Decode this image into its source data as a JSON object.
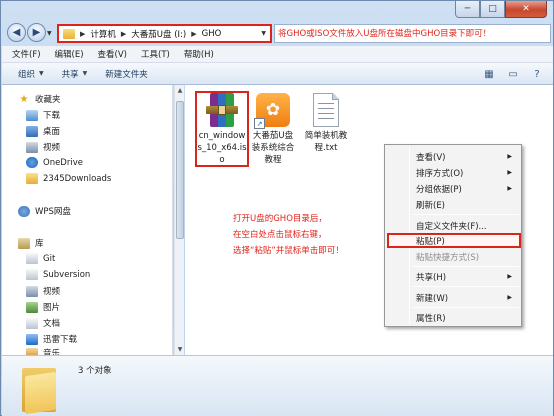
{
  "window": {
    "caption": {
      "minimize": "─",
      "maximize": "□",
      "close": "✕"
    }
  },
  "address": {
    "crumbs": [
      "计算机",
      "大番茄U盘 (I:)",
      "GHO"
    ],
    "hint": "将GHO或ISO文件放入U盘所在磁盘中GHO目录下即可！"
  },
  "menubar": {
    "items": [
      "文件(F)",
      "编辑(E)",
      "查看(V)",
      "工具(T)",
      "帮助(H)"
    ]
  },
  "cmdbar": {
    "organize": "组织",
    "share": "共享",
    "new_folder": "新建文件夹"
  },
  "navpane": {
    "favorites": "收藏夹",
    "downloads": "下载",
    "desktop": "桌面",
    "video_fav": "视频",
    "onedrive": "OneDrive",
    "dl2345": "2345Downloads",
    "wps": "WPS网盘",
    "library": "库",
    "git": "Git",
    "subversion": "Subversion",
    "video": "视频",
    "pictures": "图片",
    "documents": "文档",
    "thunder": "迅雷下载",
    "music": "音乐"
  },
  "files": [
    {
      "name": "cn_windows_10_x64.iso",
      "lines": [
        "cn_window",
        "s_10_x64.is",
        "o"
      ]
    },
    {
      "name": "大番茄U盘装系统综合教程",
      "lines": [
        "大番茄U盘",
        "装系统综合",
        "教程"
      ]
    },
    {
      "name": "简单装机教程.txt",
      "lines": [
        "简单装机教",
        "程.txt"
      ]
    }
  ],
  "instructions": {
    "line1": "打开U盘的GHO目录后，",
    "line2": "在空白处点击鼠标右键，",
    "line3": "选择“粘贴”并鼠标单击即可！"
  },
  "context_menu": {
    "view": "查看(V)",
    "sort": "排序方式(O)",
    "group": "分组依据(P)",
    "refresh": "刷新(E)",
    "customize": "自定义文件夹(F)...",
    "paste": "粘贴(P)",
    "paste_shortcut": "粘贴快捷方式(S)",
    "share": "共享(H)",
    "new": "新建(W)",
    "properties": "属性(R)"
  },
  "details": {
    "count": "3 个对象"
  }
}
